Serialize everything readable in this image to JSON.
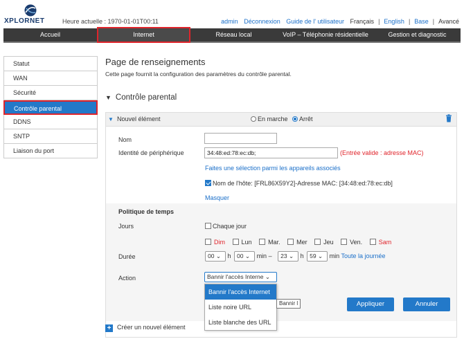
{
  "header": {
    "logo_text": "XPLORNET",
    "time_label": "Heure actuelle : 1970-01-01T00:11",
    "links": {
      "admin": "admin",
      "logout": "Déconnexion",
      "guide": "Guide de l' utilisateur",
      "lang_fr": "Français",
      "lang_en": "English",
      "base": "Base",
      "advanced": "Avancé"
    }
  },
  "nav": {
    "items": [
      "Accueil",
      "Internet",
      "Réseau local",
      "VoIP – Téléphonie résidentielle",
      "Gestion et diagnostic"
    ]
  },
  "sidebar": {
    "items": [
      "Statut",
      "WAN",
      "Sécurité",
      "Contrôle parental",
      "DDNS",
      "SNTP",
      "Liaison du port"
    ]
  },
  "main": {
    "title": "Page de renseignements",
    "description": "Cette page fournit la configuration des paramètres du contrôle parental.",
    "section_title": "Contrôle parental",
    "panel": {
      "title": "Nouvel élément",
      "radio_on": "En marche",
      "radio_off": "Arrêt",
      "name_label": "Nom",
      "name_value": "",
      "device_label": "Identité de périphérique",
      "device_value": "34:48:ed:78:ec:db;",
      "device_hint": "(Entrée valide : adresse MAC)",
      "select_devices_link": "Faites une sélection parmi les appareils associés",
      "hostname_check": "Nom de l'hôte: [FRL86X59Y2]-Adresse MAC: [34:48:ed:78:ec:db]",
      "hide_link": "Masquer",
      "policy_title": "Politique de temps",
      "days_label": "Jours",
      "every_day": "Chaque jour",
      "days": [
        "Dim",
        "Lun",
        "Mar.",
        "Mer",
        "Jeu",
        "Ven.",
        "Sam"
      ],
      "duration_label": "Durée",
      "start_h": "00",
      "start_m": "00",
      "end_h": "23",
      "end_m": "59",
      "h": "h",
      "min_sep": "min –",
      "min": "min",
      "all_day": "Toute la journée",
      "action_label": "Action",
      "action_value": "Bannir l'accès Interne",
      "action_options": [
        "Bannir l'accès Internet",
        "Liste noire URL",
        "Liste blanche des URL"
      ],
      "tooltip": "Bannir l",
      "apply": "Appliquer",
      "cancel": "Annuler"
    },
    "create_new": "Créer un nouvel élément"
  },
  "colors": {
    "accent": "#2379c9",
    "highlight_red": "#e0242b",
    "nav_bg": "#3a3a3a"
  }
}
